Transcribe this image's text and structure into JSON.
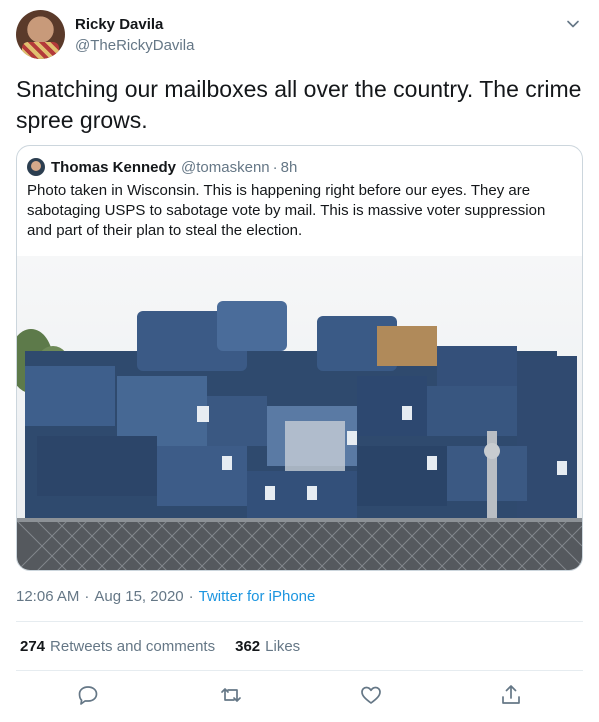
{
  "author": {
    "name": "Ricky Davila",
    "handle": "@TheRickyDavila"
  },
  "tweet_text": "Snatching our mailboxes all over the country. The crime spree grows.",
  "quoted": {
    "name": "Thomas Kennedy",
    "handle": "@tomaskenn",
    "separator": "·",
    "time": "8h",
    "text": "Photo taken in Wisconsin. This is happening right before our eyes. They are sabotaging USPS to sabotage vote by mail. This is massive voter suppression and part of their plan to steal the election."
  },
  "meta": {
    "time": "12:06 AM",
    "separator": "·",
    "date": "Aug 15, 2020",
    "source": "Twitter for iPhone"
  },
  "stats": {
    "retweets_count": "274",
    "retweets_label": "Retweets and comments",
    "likes_count": "362",
    "likes_label": "Likes"
  },
  "icons": {
    "chevron": "chevron-down-icon",
    "reply": "reply-icon",
    "retweet": "retweet-icon",
    "like": "heart-icon",
    "share": "share-icon"
  },
  "colors": {
    "text": "#14171a",
    "secondary": "#657786",
    "link": "#1b95e0",
    "border": "#ccd6dd"
  }
}
